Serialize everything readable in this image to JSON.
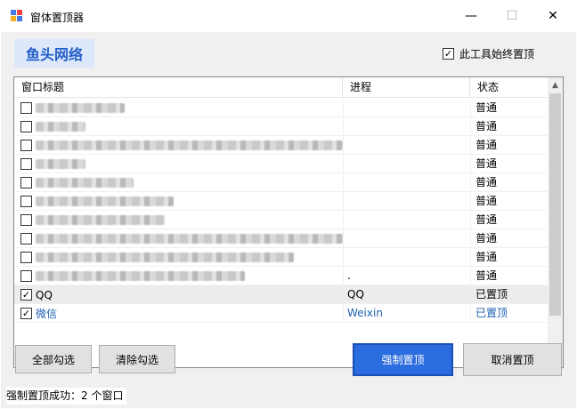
{
  "window": {
    "title": "窗体置顶器",
    "minimize": "—",
    "maximize": "☐",
    "close": "✕"
  },
  "brand": {
    "label": "鱼头网络"
  },
  "always_on_top": {
    "label": "此工具始终置顶",
    "checked": true
  },
  "table": {
    "columns": [
      "窗口标题",
      "进程",
      "状态"
    ],
    "rows": [
      {
        "checked": false,
        "title": "",
        "process": "",
        "status": "普通",
        "blur_width": 100
      },
      {
        "checked": false,
        "title": "",
        "process": "",
        "status": "普通",
        "blur_width": 56
      },
      {
        "checked": false,
        "title": "",
        "process": "",
        "status": "普通",
        "blur_width": 360
      },
      {
        "checked": false,
        "title": "",
        "process": "",
        "status": "普通",
        "blur_width": 56
      },
      {
        "checked": false,
        "title": "",
        "process": "",
        "status": "普通",
        "blur_width": 110
      },
      {
        "checked": false,
        "title": "",
        "process": "",
        "status": "普通",
        "blur_width": 155
      },
      {
        "checked": false,
        "title": "",
        "process": "",
        "status": "普通",
        "blur_width": 145
      },
      {
        "checked": false,
        "title": "",
        "process": "",
        "status": "普通",
        "blur_width": 355
      },
      {
        "checked": false,
        "title": "",
        "process": "",
        "status": "普通",
        "blur_width": 290
      },
      {
        "checked": false,
        "title": "",
        "process": ".",
        "status": "普通",
        "blur_width": 235
      },
      {
        "checked": true,
        "title": "QQ",
        "process": "QQ",
        "status": "已置顶"
      },
      {
        "checked": true,
        "title": "微信",
        "process": "Weixin",
        "status": "已置顶"
      }
    ]
  },
  "buttons": {
    "select_all": "全部勾选",
    "clear": "清除勾选",
    "force_top": "强制置顶",
    "cancel_top": "取消置顶"
  },
  "status": {
    "text": "强制置顶成功：2 个窗口"
  },
  "colors": {
    "accent": "#2b6cde",
    "brand_bg": "#dde9fb",
    "brand_text": "#2560c8"
  }
}
